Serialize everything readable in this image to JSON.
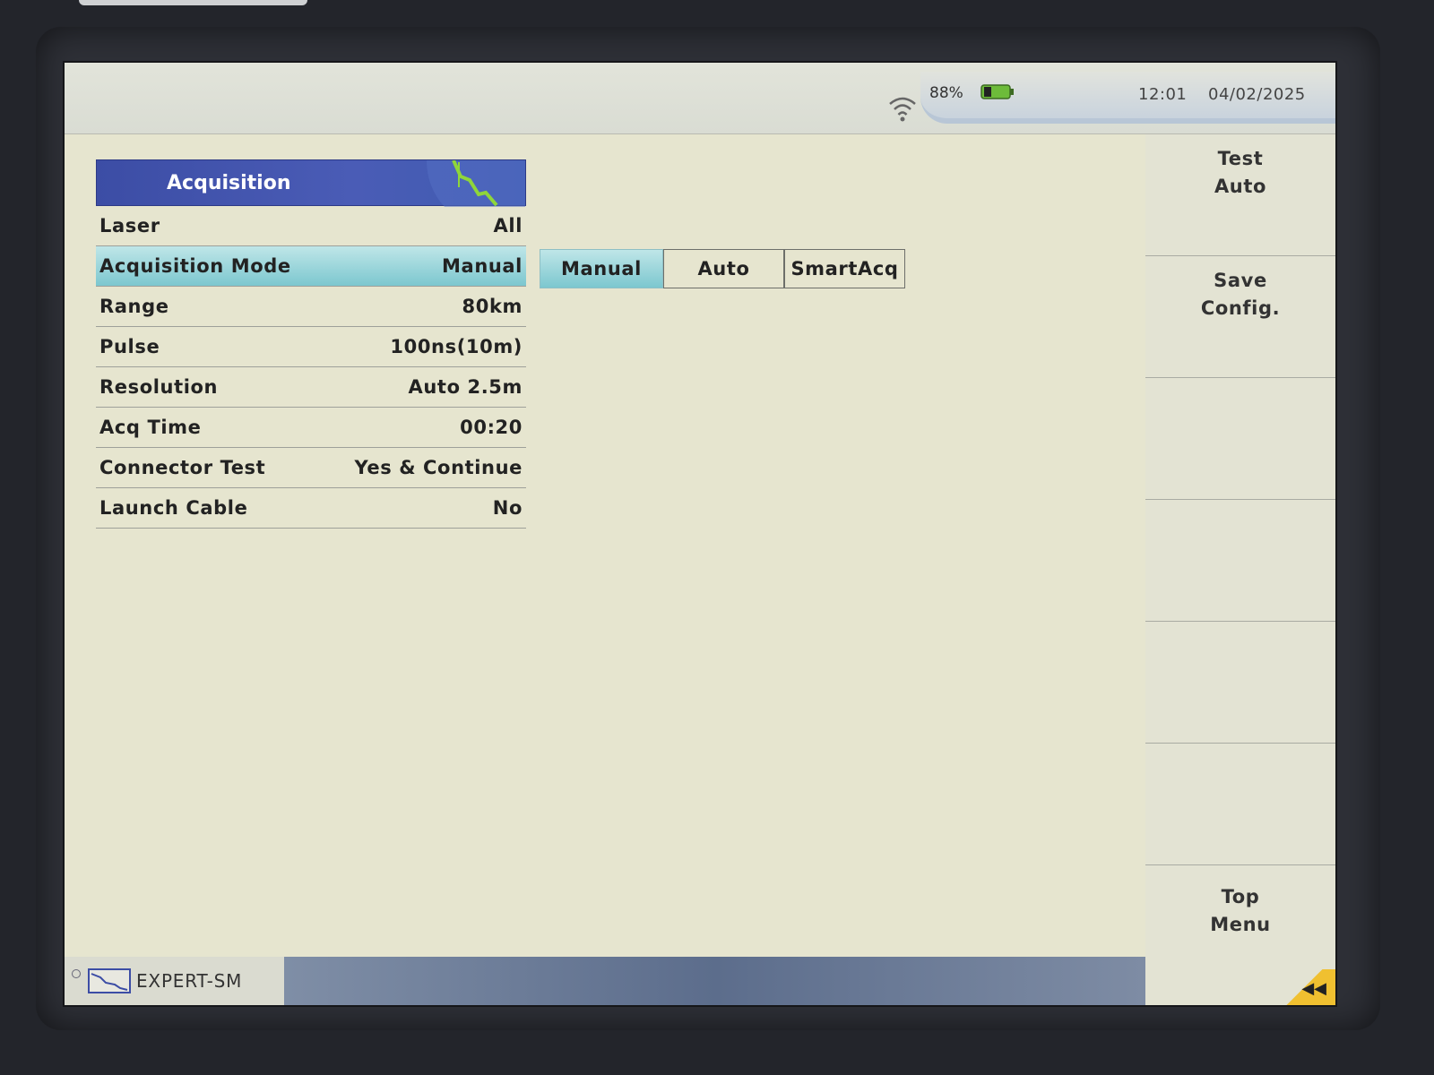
{
  "status": {
    "battery_pct": "88%",
    "time": "12:01",
    "date": "04/02/2025"
  },
  "panel": {
    "title": "Acquisition",
    "rows": [
      {
        "label": "Laser",
        "value": "All"
      },
      {
        "label": "Acquisition Mode",
        "value": "Manual"
      },
      {
        "label": "Range",
        "value": "80km"
      },
      {
        "label": "Pulse",
        "value": "100ns(10m)"
      },
      {
        "label": "Resolution",
        "value": "Auto 2.5m"
      },
      {
        "label": "Acq Time",
        "value": "00:20"
      },
      {
        "label": "Connector Test",
        "value": "Yes & Continue"
      },
      {
        "label": "Launch Cable",
        "value": "No"
      }
    ]
  },
  "mode_options": [
    "Manual",
    "Auto",
    "SmartAcq"
  ],
  "softkeys": {
    "test_auto_1": "Test",
    "test_auto_2": "Auto",
    "save_config_1": "Save",
    "save_config_2": "Config.",
    "top_menu_1": "Top",
    "top_menu_2": "Menu"
  },
  "bottom": {
    "module_label": "EXPERT-SM"
  },
  "colors": {
    "header_blue": "#4a5cb6",
    "selection_cyan": "#7cc7cf",
    "screen_bg": "#e6e5cf",
    "corner_yellow": "#f0c030"
  }
}
